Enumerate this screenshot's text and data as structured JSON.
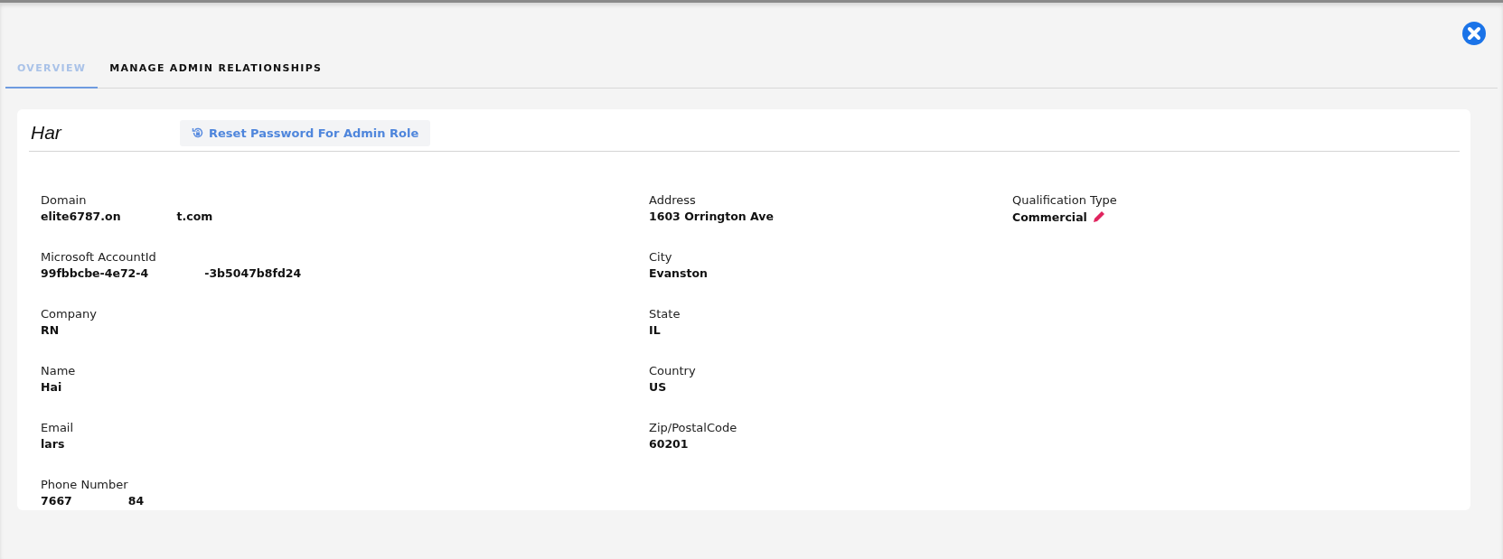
{
  "tabs": [
    {
      "label": "OVERVIEW",
      "selected": true
    },
    {
      "label": "MANAGE ADMIN RELATIONSHIPS",
      "selected": false
    }
  ],
  "header": {
    "title": "Har",
    "reset_button": "Reset Password For Admin Role"
  },
  "columns": [
    [
      {
        "label": "Domain",
        "value_parts": [
          "elite6787.on",
          "t.com"
        ]
      },
      {
        "label": "Microsoft AccountId",
        "value_parts": [
          "99fbbcbe-4e72-4",
          "-3b5047b8fd24"
        ]
      },
      {
        "label": "Company",
        "value_parts": [
          "RN"
        ]
      },
      {
        "label": "Name",
        "value_parts": [
          "Hai"
        ]
      },
      {
        "label": "Email",
        "value_parts": [
          "lars"
        ]
      },
      {
        "label": "Phone Number",
        "value_parts": [
          "7667",
          "84"
        ]
      }
    ],
    [
      {
        "label": "Address",
        "value_parts": [
          "1603 Orrington Ave"
        ]
      },
      {
        "label": "City",
        "value_parts": [
          "Evanston"
        ]
      },
      {
        "label": "State",
        "value_parts": [
          "IL"
        ]
      },
      {
        "label": "Country",
        "value_parts": [
          "US"
        ]
      },
      {
        "label": "Zip/PostalCode",
        "value_parts": [
          "60201"
        ]
      }
    ],
    [
      {
        "label": "Qualification Type",
        "value_parts": [
          "Commercial"
        ],
        "editable": true
      }
    ]
  ]
}
